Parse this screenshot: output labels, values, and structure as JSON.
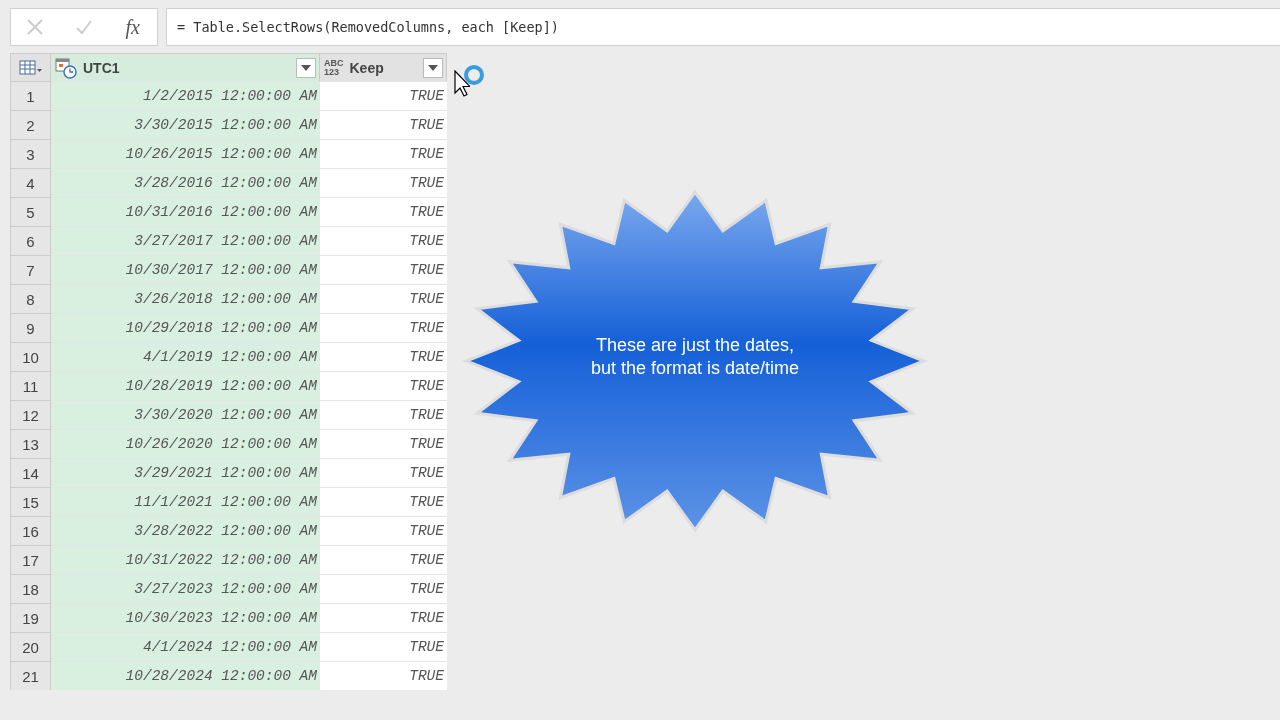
{
  "formula_bar": {
    "formula": "= Table.SelectRows(RemovedColumns, each [Keep])",
    "fx_label": "fx"
  },
  "table": {
    "columns": [
      {
        "name": "UTC1",
        "kind": "datetime",
        "selected": true
      },
      {
        "name": "Keep",
        "type_label": "ABC\n123",
        "kind": "any",
        "selected": false
      }
    ],
    "rows": [
      {
        "index": "1",
        "utc1": "1/2/2015 12:00:00 AM",
        "keep": "TRUE"
      },
      {
        "index": "2",
        "utc1": "3/30/2015 12:00:00 AM",
        "keep": "TRUE"
      },
      {
        "index": "3",
        "utc1": "10/26/2015 12:00:00 AM",
        "keep": "TRUE"
      },
      {
        "index": "4",
        "utc1": "3/28/2016 12:00:00 AM",
        "keep": "TRUE"
      },
      {
        "index": "5",
        "utc1": "10/31/2016 12:00:00 AM",
        "keep": "TRUE"
      },
      {
        "index": "6",
        "utc1": "3/27/2017 12:00:00 AM",
        "keep": "TRUE"
      },
      {
        "index": "7",
        "utc1": "10/30/2017 12:00:00 AM",
        "keep": "TRUE"
      },
      {
        "index": "8",
        "utc1": "3/26/2018 12:00:00 AM",
        "keep": "TRUE"
      },
      {
        "index": "9",
        "utc1": "10/29/2018 12:00:00 AM",
        "keep": "TRUE"
      },
      {
        "index": "10",
        "utc1": "4/1/2019 12:00:00 AM",
        "keep": "TRUE"
      },
      {
        "index": "11",
        "utc1": "10/28/2019 12:00:00 AM",
        "keep": "TRUE"
      },
      {
        "index": "12",
        "utc1": "3/30/2020 12:00:00 AM",
        "keep": "TRUE"
      },
      {
        "index": "13",
        "utc1": "10/26/2020 12:00:00 AM",
        "keep": "TRUE"
      },
      {
        "index": "14",
        "utc1": "3/29/2021 12:00:00 AM",
        "keep": "TRUE"
      },
      {
        "index": "15",
        "utc1": "11/1/2021 12:00:00 AM",
        "keep": "TRUE"
      },
      {
        "index": "16",
        "utc1": "3/28/2022 12:00:00 AM",
        "keep": "TRUE"
      },
      {
        "index": "17",
        "utc1": "10/31/2022 12:00:00 AM",
        "keep": "TRUE"
      },
      {
        "index": "18",
        "utc1": "3/27/2023 12:00:00 AM",
        "keep": "TRUE"
      },
      {
        "index": "19",
        "utc1": "10/30/2023 12:00:00 AM",
        "keep": "TRUE"
      },
      {
        "index": "20",
        "utc1": "4/1/2024 12:00:00 AM",
        "keep": "TRUE"
      },
      {
        "index": "21",
        "utc1": "10/28/2024 12:00:00 AM",
        "keep": "TRUE"
      }
    ]
  },
  "callout": {
    "lines": [
      "These are just the dates,",
      "but the format is date/time"
    ]
  }
}
